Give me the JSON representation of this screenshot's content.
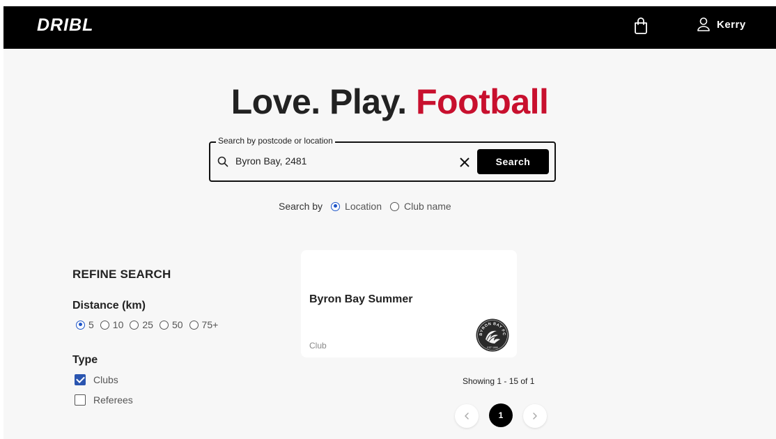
{
  "header": {
    "logo": "DRIBL",
    "cart_icon": "shopping-bag-icon",
    "user_icon": "user-icon",
    "user_name": "Kerry"
  },
  "hero": {
    "title_part1": "Love. Play. ",
    "title_accent": "Football",
    "accent_color": "#c8102e"
  },
  "search": {
    "legend": "Search by postcode or location",
    "value": "Byron Bay, 2481",
    "button_label": "Search",
    "search_by_label": "Search by",
    "options": [
      {
        "label": "Location",
        "checked": true
      },
      {
        "label": "Club name",
        "checked": false
      }
    ]
  },
  "refine": {
    "title": "REFINE SEARCH",
    "distance_title": "Distance (km)",
    "distances": [
      {
        "label": "5",
        "checked": true
      },
      {
        "label": "10",
        "checked": false
      },
      {
        "label": "25",
        "checked": false
      },
      {
        "label": "50",
        "checked": false
      },
      {
        "label": "75+",
        "checked": false
      }
    ],
    "type_title": "Type",
    "types": [
      {
        "label": "Clubs",
        "checked": true
      },
      {
        "label": "Referees",
        "checked": false
      }
    ]
  },
  "results": {
    "cards": [
      {
        "title": "Byron Bay Summer",
        "type": "Club",
        "logo_text": "BYRON BAY FC",
        "logo_year": "EST 1999"
      }
    ],
    "showing": "Showing 1 - 15 of 1",
    "pagination": {
      "current_page": "1"
    }
  },
  "colors": {
    "topbar": "#000000",
    "background": "#f7f7f7",
    "accent": "#c8102e",
    "radio_selected": "#1e55c8",
    "checkbox_selected": "#2a55b0"
  }
}
